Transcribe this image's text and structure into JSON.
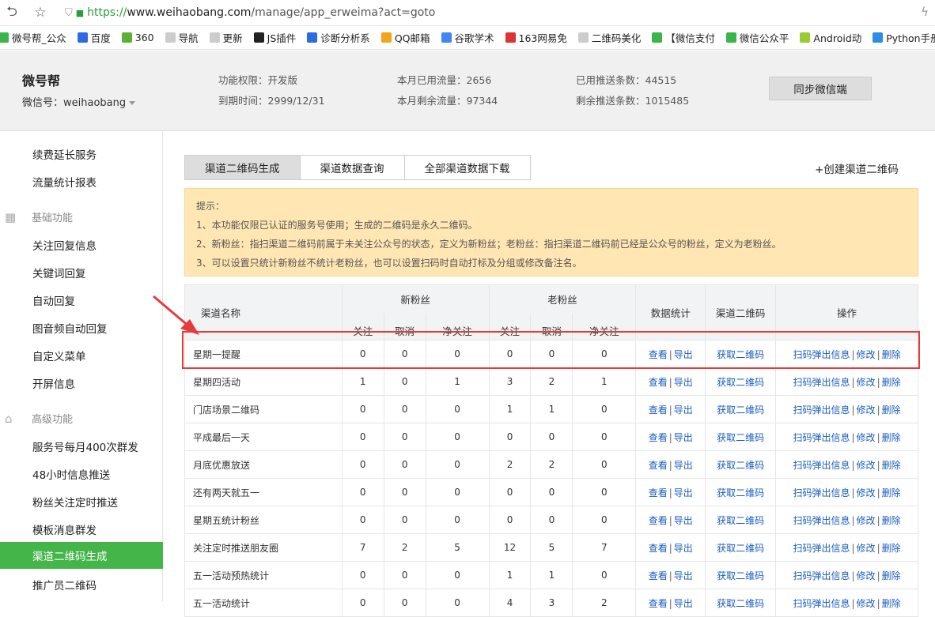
{
  "browser": {
    "url_scheme": "https://",
    "url_host": "www.weihaobang.com",
    "url_path": "/manage/app_erweima?act=goto"
  },
  "bookmarks": [
    {
      "label": "微号帮_公众",
      "color": "#3ab54a"
    },
    {
      "label": "百度",
      "color": "#2d6be3"
    },
    {
      "label": "360",
      "color": "#5cb130"
    },
    {
      "label": "导航",
      "color": "#cccccc"
    },
    {
      "label": "更新",
      "color": "#cccccc"
    },
    {
      "label": "JS插件",
      "color": "#222222"
    },
    {
      "label": "诊断分析系",
      "color": "#2d6be3"
    },
    {
      "label": "QQ邮箱",
      "color": "#f2a41b"
    },
    {
      "label": "谷歌学术",
      "color": "#4285f4"
    },
    {
      "label": "163网易免",
      "color": "#d33"
    },
    {
      "label": "二维码美化",
      "color": "#cccccc"
    },
    {
      "label": "【微信支付",
      "color": "#3ab54a"
    },
    {
      "label": "微信公众平",
      "color": "#3ab54a"
    },
    {
      "label": "Android动",
      "color": "#9c3"
    },
    {
      "label": "Python手册",
      "color": "#2d8ce3"
    }
  ],
  "header": {
    "name": "微号帮",
    "wechat": "微信号：weihaobang",
    "perm": "功能权限：开发版",
    "expire": "到期时间：2999/12/31",
    "used_flow": "本月已用流量：2656",
    "remain_flow": "本月剩余流量：97344",
    "used_push": "已用推送条数：44515",
    "remain_push": "剩余推送条数：1015485",
    "sync_label": "同步微信端"
  },
  "sidebar": {
    "top_items": [
      "续费延长服务",
      "流量统计报表"
    ],
    "group_basic": "基础功能",
    "basic_items": [
      "关注回复信息",
      "关键词回复",
      "自动回复",
      "图音频自动回复",
      "自定义菜单",
      "开屏信息"
    ],
    "group_adv": "高级功能",
    "adv_items": [
      "服务号每月400次群发",
      "48小时信息推送",
      "粉丝关注定时推送",
      "模板消息群发"
    ],
    "active": "渠道二维码生成",
    "after_active": "推广员二维码"
  },
  "tabs": [
    "渠道二维码生成",
    "渠道数据查询",
    "全部渠道数据下载"
  ],
  "create_label": "+创建渠道二维码",
  "tip": {
    "title": "提示：",
    "l1": "1、本功能仅限已认证的服务号使用；生成的二维码是永久二维码。",
    "l2": "2、新粉丝：指扫渠道二维码前属于未关注公众号的状态，定义为新粉丝；老粉丝：指扫渠道二维码前已经是公众号的粉丝，定义为老粉丝。",
    "l3": "3、可以设置只统计新粉丝不统计老粉丝，也可以设置扫码时自动打标及分组或修改备注名。"
  },
  "table": {
    "h_name": "渠道名称",
    "h_new": "新粉丝",
    "h_old": "老粉丝",
    "h_stat": "数据统计",
    "h_qr": "渠道二维码",
    "h_op": "操作",
    "h_follow": "关注",
    "h_cancel": "取消",
    "h_net": "净关注",
    "view": "查看",
    "export": "导出",
    "get_qr": "获取二维码",
    "popup": "扫码弹出信息",
    "edit": "修改",
    "del": "删除",
    "rows": [
      {
        "name": "星期一提醒",
        "v": [
          "0",
          "0",
          "0",
          "0",
          "0",
          "0"
        ]
      },
      {
        "name": "星期四活动",
        "v": [
          "1",
          "0",
          "1",
          "3",
          "2",
          "1"
        ]
      },
      {
        "name": "门店场景二维码",
        "v": [
          "0",
          "0",
          "0",
          "1",
          "1",
          "0"
        ]
      },
      {
        "name": "平成最后一天",
        "v": [
          "0",
          "0",
          "0",
          "0",
          "0",
          "0"
        ]
      },
      {
        "name": "月底优惠放送",
        "v": [
          "0",
          "0",
          "0",
          "2",
          "2",
          "0"
        ]
      },
      {
        "name": "还有两天就五一",
        "v": [
          "0",
          "0",
          "0",
          "0",
          "0",
          "0"
        ]
      },
      {
        "name": "星期五统计粉丝",
        "v": [
          "0",
          "0",
          "0",
          "0",
          "0",
          "0"
        ]
      },
      {
        "name": "关注定时推送朋友圈",
        "v": [
          "7",
          "2",
          "5",
          "12",
          "5",
          "7"
        ]
      },
      {
        "name": "五一活动预热统计",
        "v": [
          "0",
          "0",
          "0",
          "1",
          "1",
          "0"
        ]
      },
      {
        "name": "五一活动统计",
        "v": [
          "0",
          "0",
          "0",
          "4",
          "3",
          "2"
        ]
      }
    ]
  }
}
